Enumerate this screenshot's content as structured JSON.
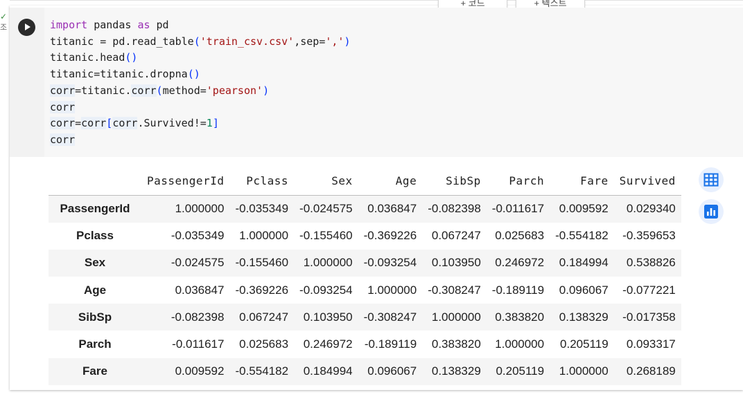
{
  "gutter": {
    "check_glyph": "✓",
    "exec_char": "조"
  },
  "toolbar": {
    "add_code_label": "+ 코드",
    "add_text_label": "+ 텍스트"
  },
  "code": {
    "lines": [
      "import pandas as pd",
      "titanic = pd.read_table('train_csv.csv',sep=',')",
      "titanic.head()",
      "titanic=titanic.dropna()",
      "corr=titanic.corr(method='pearson')",
      "corr",
      "corr=corr[corr.Survived!=1]",
      "corr"
    ]
  },
  "output_table": {
    "columns": [
      "PassengerId",
      "Pclass",
      "Sex",
      "Age",
      "SibSp",
      "Parch",
      "Fare",
      "Survived"
    ],
    "rows": [
      {
        "index": "PassengerId",
        "values": [
          "1.000000",
          "-0.035349",
          "-0.024575",
          "0.036847",
          "-0.082398",
          "-0.011617",
          "0.009592",
          "0.029340"
        ]
      },
      {
        "index": "Pclass",
        "values": [
          "-0.035349",
          "1.000000",
          "-0.155460",
          "-0.369226",
          "0.067247",
          "0.025683",
          "-0.554182",
          "-0.359653"
        ]
      },
      {
        "index": "Sex",
        "values": [
          "-0.024575",
          "-0.155460",
          "1.000000",
          "-0.093254",
          "0.103950",
          "0.246972",
          "0.184994",
          "0.538826"
        ]
      },
      {
        "index": "Age",
        "values": [
          "0.036847",
          "-0.369226",
          "-0.093254",
          "1.000000",
          "-0.308247",
          "-0.189119",
          "0.096067",
          "-0.077221"
        ]
      },
      {
        "index": "SibSp",
        "values": [
          "-0.082398",
          "0.067247",
          "0.103950",
          "-0.308247",
          "1.000000",
          "0.383820",
          "0.138329",
          "-0.017358"
        ]
      },
      {
        "index": "Parch",
        "values": [
          "-0.011617",
          "0.025683",
          "0.246972",
          "-0.189119",
          "0.383820",
          "1.000000",
          "0.205119",
          "0.093317"
        ]
      },
      {
        "index": "Fare",
        "values": [
          "0.009592",
          "-0.554182",
          "0.184994",
          "0.096067",
          "0.138329",
          "0.205119",
          "1.000000",
          "0.268189"
        ]
      }
    ]
  },
  "side_icons": [
    "table-icon",
    "bar-chart-icon"
  ],
  "colors": {
    "accent": "#1a73e8",
    "icon_bg": "#e8f0fe",
    "run_button": "#2b2b2b"
  }
}
